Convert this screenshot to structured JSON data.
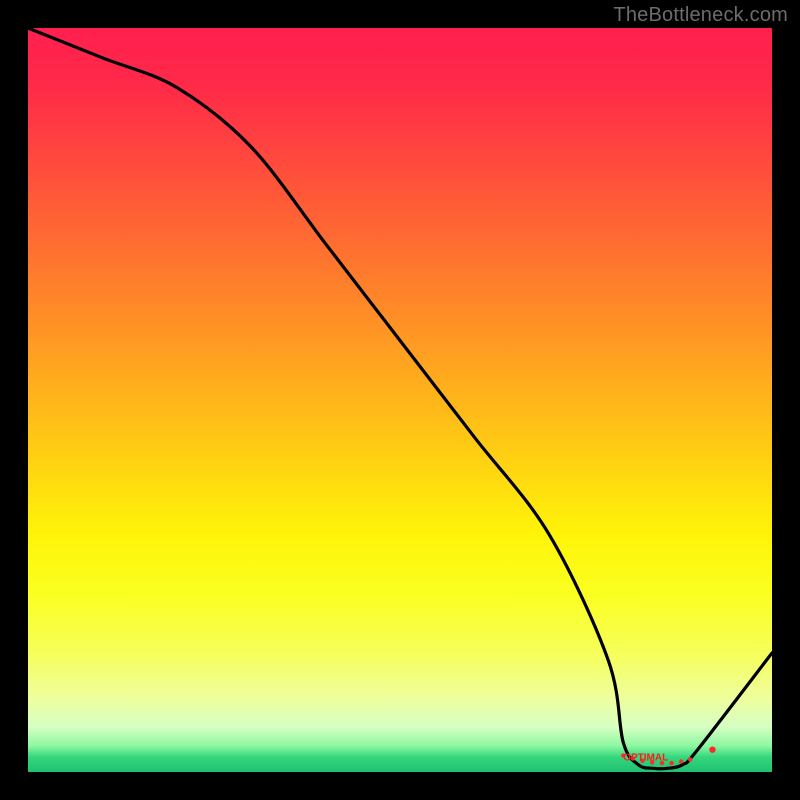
{
  "watermark": "TheBottleneck.com",
  "optimal_label": "OPTIMAL",
  "chart_data": {
    "type": "line",
    "title": "",
    "xlabel": "",
    "ylabel": "",
    "xlim": [
      0,
      100
    ],
    "ylim": [
      0,
      100
    ],
    "x": [
      0,
      10,
      20,
      30,
      40,
      50,
      60,
      70,
      78,
      80,
      82,
      84,
      86,
      88,
      90,
      100
    ],
    "values": [
      100,
      96,
      92,
      84,
      71,
      58,
      45,
      32,
      15,
      4,
      1,
      0.5,
      0.5,
      1,
      3,
      16
    ],
    "optimal_x": 85,
    "optimal_points_x": [
      80,
      81.3,
      82.6,
      83.9,
      85.2,
      86.5,
      87.8,
      89,
      92
    ],
    "optimal_points_y": [
      2.2,
      1.8,
      1.5,
      1.3,
      1.2,
      1.2,
      1.4,
      1.7,
      3.0
    ],
    "gradient_note": "red (top) -> yellow -> pale -> green (bottom)"
  }
}
